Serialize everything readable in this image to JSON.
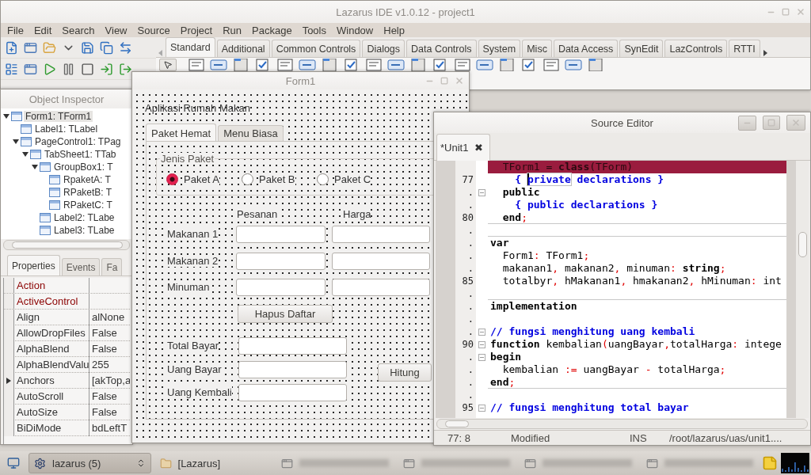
{
  "ide": {
    "title": "Lazarus IDE v1.0.12 - project1",
    "menu": [
      "File",
      "Edit",
      "Search",
      "View",
      "Source",
      "Project",
      "Run",
      "Package",
      "Tools",
      "Window",
      "Help"
    ],
    "palette_tabs": [
      {
        "label": "Standard",
        "selected": true
      },
      {
        "label": "Additional",
        "selected": false
      },
      {
        "label": "Common Controls",
        "selected": false
      },
      {
        "label": "Dialogs",
        "selected": false
      },
      {
        "label": "Data Controls",
        "selected": false
      },
      {
        "label": "System",
        "selected": false
      },
      {
        "label": "Misc",
        "selected": false
      },
      {
        "label": "Data Access",
        "selected": false
      },
      {
        "label": "SynEdit",
        "selected": false
      },
      {
        "label": "LazControls",
        "selected": false
      },
      {
        "label": "RTTI",
        "selected": false
      }
    ]
  },
  "object_inspector": {
    "title": "Object Inspector",
    "tree": [
      {
        "label": "Form1: TForm1",
        "selected": true,
        "expanded": true,
        "children": [
          {
            "label": "Label1: TLabel",
            "selected": false
          },
          {
            "label": "PageControl1: TPag",
            "selected": false,
            "expanded": true,
            "children": [
              {
                "label": "TabSheet1: TTab",
                "selected": false,
                "expanded": true,
                "children": [
                  {
                    "label": "GroupBox1: T",
                    "selected": false,
                    "expanded": true,
                    "children": [
                      {
                        "label": "RpaketA: T",
                        "selected": false
                      },
                      {
                        "label": "RPaketB: T",
                        "selected": false
                      },
                      {
                        "label": "RPaketC: T",
                        "selected": false
                      }
                    ]
                  },
                  {
                    "label": "Label2: TLabe",
                    "selected": false
                  },
                  {
                    "label": "Label3: TLabe",
                    "selected": false
                  }
                ]
              }
            ]
          }
        ]
      }
    ],
    "tabs": [
      {
        "label": "Properties",
        "selected": true
      },
      {
        "label": "Events",
        "selected": false
      },
      {
        "label": "Fa",
        "selected": false
      }
    ],
    "properties": [
      {
        "name": "Action",
        "kind": "reference"
      },
      {
        "name": "ActiveControl",
        "kind": "reference"
      },
      {
        "name": "Align",
        "value": "alNone",
        "kind": "plain"
      },
      {
        "name": "AllowDropFiles",
        "value": "False",
        "kind": "plain"
      },
      {
        "name": "AlphaBlend",
        "value": "False",
        "kind": "plain"
      },
      {
        "name": "AlphaBlendValu",
        "value": "255",
        "kind": "plain"
      },
      {
        "name": "Anchors",
        "value": "[akTop,a",
        "kind": "plain",
        "expandable": true
      },
      {
        "name": "AutoScroll",
        "value": "False",
        "kind": "plain"
      },
      {
        "name": "AutoSize",
        "value": "False",
        "kind": "plain"
      },
      {
        "name": "BiDiMode",
        "value": "bdLeftT",
        "kind": "plain"
      }
    ]
  },
  "form": {
    "title": "Form1",
    "caption": "Aplikasi Rumah Makan",
    "tabs": [
      {
        "label": "Paket Hemat",
        "selected": true
      },
      {
        "label": "Menu Biasa",
        "selected": false
      }
    ],
    "group": {
      "title": "Jenis Paket",
      "options": [
        {
          "label": "Paket A",
          "selected": true
        },
        {
          "label": "Paket B",
          "selected": false
        },
        {
          "label": "Paket C",
          "selected": false
        }
      ]
    },
    "columns": [
      "Pesanan",
      "Harga"
    ],
    "order_rows": [
      {
        "label": "Makanan 1"
      },
      {
        "label": "Makanan 2"
      },
      {
        "label": "Minuman"
      }
    ],
    "clear_button": "Hapus Daftar",
    "payment_rows": [
      {
        "label": "Total Bayar"
      },
      {
        "label": "Uang Bayar"
      },
      {
        "label": "Uang Kembali"
      }
    ],
    "calc_button": "Hitung"
  },
  "editor": {
    "title": "Source Editor",
    "tab": {
      "label": "*Unit1",
      "close": "✖"
    },
    "lines": [
      {
        "highlighted": true,
        "tokens": [
          {
            "kind": "plain",
            "text": "  TForm1 "
          },
          {
            "kind": "sym",
            "text": "="
          },
          {
            "kind": "kw",
            "text": " class"
          },
          {
            "kind": "sym",
            "text": "("
          },
          {
            "kind": "plain",
            "text": "TForm"
          },
          {
            "kind": "sym",
            "text": ")"
          }
        ]
      },
      {
        "number": "77",
        "tokens": [
          {
            "kind": "comment",
            "text": "    { "
          },
          {
            "kind": "comment",
            "text": "private",
            "boxed": true,
            "caret": true
          },
          {
            "kind": "comment",
            "text": " declarations }"
          }
        ]
      },
      {
        "number": ".",
        "fold": true,
        "tokens": [
          {
            "kind": "kw",
            "text": "  public"
          }
        ]
      },
      {
        "number": ".",
        "tokens": [
          {
            "kind": "comment",
            "text": "    { public declarations }"
          }
        ]
      },
      {
        "number": "80",
        "divider": true,
        "tokens": [
          {
            "kind": "kw",
            "text": "  end"
          },
          {
            "kind": "sym",
            "text": ";"
          }
        ]
      },
      {
        "number": ".",
        "divider": true
      },
      {
        "number": ".",
        "tokens": [
          {
            "kind": "kw",
            "text": "var"
          }
        ]
      },
      {
        "number": ".",
        "tokens": [
          {
            "kind": "plain",
            "text": "  Form1"
          },
          {
            "kind": "sym",
            "text": ":"
          },
          {
            "kind": "plain",
            "text": " TForm1"
          },
          {
            "kind": "sym",
            "text": ";"
          }
        ]
      },
      {
        "number": ".",
        "tokens": [
          {
            "kind": "plain",
            "text": "  makanan1"
          },
          {
            "kind": "sym",
            "text": ","
          },
          {
            "kind": "plain",
            "text": " makanan2"
          },
          {
            "kind": "sym",
            "text": ","
          },
          {
            "kind": "plain",
            "text": " minuman"
          },
          {
            "kind": "sym",
            "text": ":"
          },
          {
            "kind": "kw",
            "text": " string"
          },
          {
            "kind": "sym",
            "text": ";"
          }
        ]
      },
      {
        "number": "85",
        "tokens": [
          {
            "kind": "plain",
            "text": "  totalbyr"
          },
          {
            "kind": "sym",
            "text": ","
          },
          {
            "kind": "plain",
            "text": " hMakanan1"
          },
          {
            "kind": "sym",
            "text": ","
          },
          {
            "kind": "plain",
            "text": " hmakanan2"
          },
          {
            "kind": "sym",
            "text": ","
          },
          {
            "kind": "plain",
            "text": " hMinuman"
          },
          {
            "kind": "sym",
            "text": ":"
          },
          {
            "kind": "plain",
            "text": " int"
          }
        ]
      },
      {
        "number": ".",
        "divider": true
      },
      {
        "number": ".",
        "tokens": [
          {
            "kind": "kw",
            "text": "implementation"
          }
        ]
      },
      {
        "number": "."
      },
      {
        "number": ".",
        "fold": true,
        "tokens": [
          {
            "kind": "comment",
            "text": "// fungsi menghitung uang kembali"
          }
        ]
      },
      {
        "number": "90",
        "fold": true,
        "tokens": [
          {
            "kind": "kw",
            "text": "function"
          },
          {
            "kind": "plain",
            "text": " kembalian"
          },
          {
            "kind": "sym",
            "text": "("
          },
          {
            "kind": "plain",
            "text": "uangBayar"
          },
          {
            "kind": "sym",
            "text": ","
          },
          {
            "kind": "plain",
            "text": "totalHarga"
          },
          {
            "kind": "sym",
            "text": ":"
          },
          {
            "kind": "plain",
            "text": " intege"
          }
        ]
      },
      {
        "number": ".",
        "fold": true,
        "tokens": [
          {
            "kind": "kw",
            "text": "begin"
          }
        ]
      },
      {
        "number": ".",
        "tokens": [
          {
            "kind": "plain",
            "text": "  kembalian "
          },
          {
            "kind": "sym",
            "text": ":="
          },
          {
            "kind": "plain",
            "text": " uangBayar "
          },
          {
            "kind": "sym",
            "text": "-"
          },
          {
            "kind": "plain",
            "text": " totalHarga"
          },
          {
            "kind": "sym",
            "text": ";"
          }
        ]
      },
      {
        "number": ".",
        "divider": true,
        "tokens": [
          {
            "kind": "kw",
            "text": "end"
          },
          {
            "kind": "sym",
            "text": ";"
          }
        ]
      },
      {
        "number": "."
      },
      {
        "number": "95",
        "fold": true,
        "tokens": [
          {
            "kind": "comment",
            "text": "// fungsi menghitung total bayar"
          }
        ]
      }
    ],
    "status": [
      "77:  8",
      "Modified",
      "INS",
      "/root/lazarus/uas/unit1...."
    ]
  },
  "taskbar": {
    "items": [
      {
        "label": "lazarus (5)",
        "kind": "group"
      },
      {
        "label": "[Lazarus]",
        "kind": "folder"
      },
      {
        "kind": "blurred"
      },
      {
        "kind": "blurred"
      },
      {
        "kind": "blurred"
      },
      {
        "kind": "blurred"
      }
    ]
  }
}
